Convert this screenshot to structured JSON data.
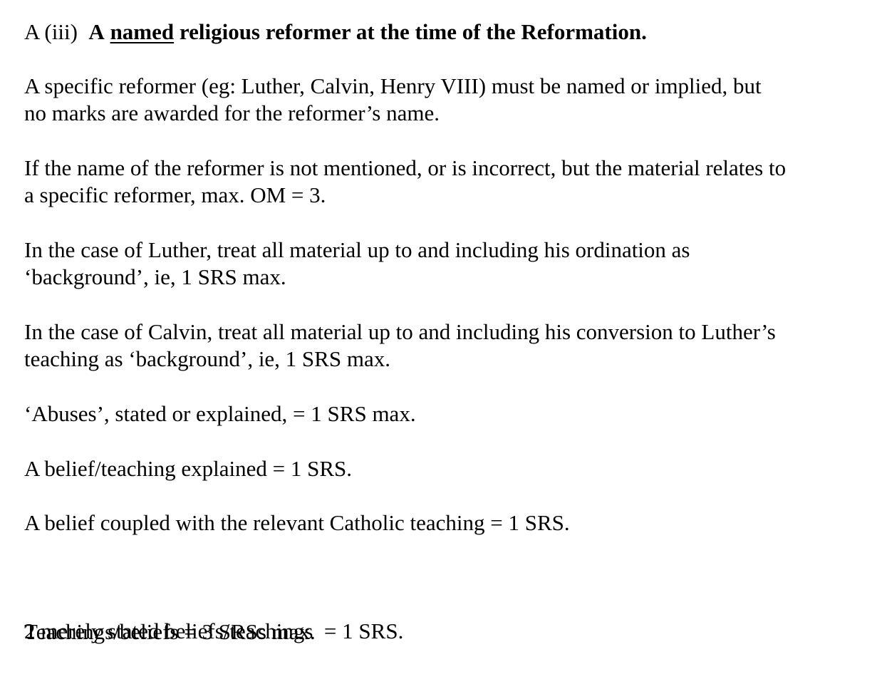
{
  "heading": {
    "label": "A (iii)",
    "article": "A",
    "underlined": "named",
    "rest": "religious reformer at the time of the Reformation."
  },
  "paragraphs": [
    {
      "lines": [
        "A specific reformer (eg: Luther, Calvin, Henry VIII) must be named or implied, but",
        "no marks are awarded for the reformer’s name."
      ]
    },
    {
      "lines": [
        "If the name of the reformer is not mentioned, or is incorrect, but the material relates to",
        "a specific reformer, max. OM = 3."
      ]
    },
    {
      "lines": [
        "In the case of Luther, treat all material up to and including his ordination as",
        "‘background’, ie, 1 SRS max."
      ]
    },
    {
      "lines": [
        "In the case of Calvin, treat all material up to and including his conversion to Luther’s",
        "teaching as ‘background’, ie, 1 SRS max."
      ]
    },
    {
      "lines": [
        "‘Abuses’, stated or explained, = 1 SRS max."
      ]
    },
    {
      "lines": [
        "A belief/teaching explained = 1 SRS."
      ]
    },
    {
      "lines": [
        "A belief coupled with the relevant Catholic teaching = 1 SRS."
      ]
    },
    {
      "lines": [
        "2 merely stated beliefs/teachings  = 1 SRS."
      ]
    },
    {
      "lines": [
        "Teachings/beliefs = 3 SRSs max."
      ]
    }
  ]
}
